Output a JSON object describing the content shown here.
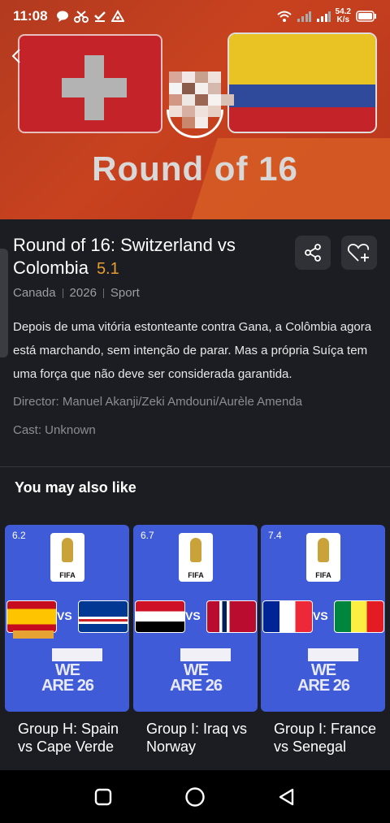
{
  "status_bar": {
    "time": "11:08",
    "speed_value": "54.2",
    "speed_unit": "K/s"
  },
  "hero": {
    "image_title": "Round of 16"
  },
  "detail": {
    "title": "Round of 16: Switzerland vs Colombia",
    "rating": "5.1",
    "meta": [
      "Canada",
      "2026",
      "Sport"
    ],
    "description": "Depois de uma vitória estonteante contra Gana, a Colômbia agora está marchando, sem intenção de parar. Mas a própria Suíça tem uma força que não deve ser considerada garantida.",
    "director": "Director: Manuel Akanji/Zeki Amdouni/Aurèle Amenda",
    "cast": "Cast: Unknown"
  },
  "related": {
    "section_title": "You may also like",
    "items": [
      {
        "score": "6.2",
        "title": "Group H: Spain vs Cape Verde",
        "fifa_label": "FIFA",
        "vs": "VS",
        "badge": "WE ARE 26"
      },
      {
        "score": "6.7",
        "title": "Group I: Iraq vs Norway",
        "fifa_label": "FIFA",
        "vs": "VS",
        "badge": "WE ARE 26"
      },
      {
        "score": "7.4",
        "title": "Group I: France vs Senegal",
        "fifa_label": "FIFA",
        "vs": "VS",
        "badge": "WE ARE 26"
      }
    ]
  },
  "colors": {
    "background": "#1c1d22",
    "rating": "#e79d2f",
    "poster_blue": "#3f5bd8"
  },
  "icons": [
    "back-arrow-icon",
    "share-icon",
    "heart-plus-icon",
    "square-nav-icon",
    "circle-nav-icon",
    "triangle-back-nav-icon"
  ]
}
